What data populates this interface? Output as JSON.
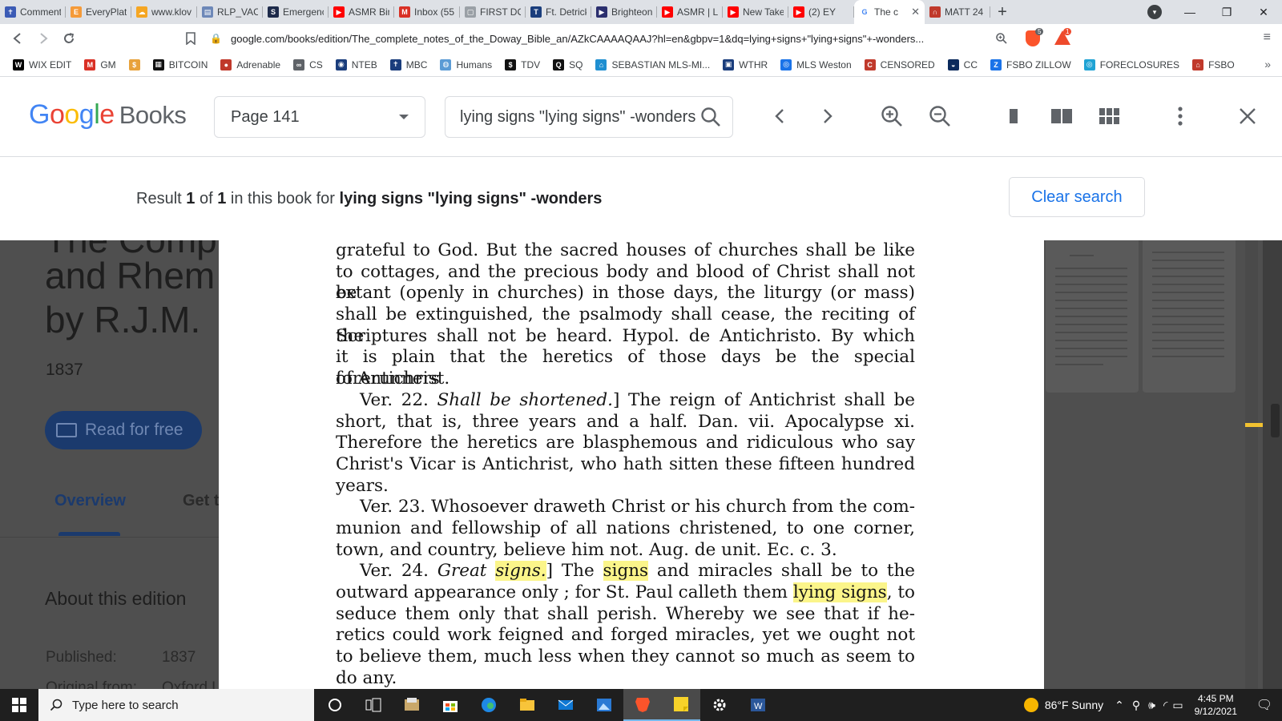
{
  "browser": {
    "tabs": [
      {
        "title": "Comment",
        "icon": "cross-icon",
        "color": "#3b5bb5"
      },
      {
        "title": "EveryPlate",
        "icon": "everyplate-icon",
        "color": "#f59a38"
      },
      {
        "title": "www.klov",
        "icon": "cloud-icon",
        "color": "#f5a623"
      },
      {
        "title": "RLP_VACC",
        "icon": "document-icon",
        "color": "#6d88b8"
      },
      {
        "title": "Emergenc",
        "icon": "shield-icon",
        "color": "#1d2a4a"
      },
      {
        "title": "ASMR Bin",
        "icon": "youtube-icon",
        "color": "#ff0000"
      },
      {
        "title": "Inbox (55",
        "icon": "gmail-icon",
        "color": "#d93025"
      },
      {
        "title": "FIRST DO",
        "icon": "page-icon",
        "color": "#9aa0a6"
      },
      {
        "title": "Ft. Detrick",
        "icon": "tru-icon",
        "color": "#1a3d7c"
      },
      {
        "title": "Brighteon",
        "icon": "play-icon",
        "color": "#2b2f6e"
      },
      {
        "title": "ASMR | L",
        "icon": "youtube-icon",
        "color": "#ff0000"
      },
      {
        "title": "New Take",
        "icon": "youtube-icon",
        "color": "#ff0000"
      },
      {
        "title": "(2) EY",
        "icon": "youtube-icon",
        "color": "#ff0000"
      },
      {
        "title": "The c",
        "icon": "google-icon",
        "color": "#4285f4",
        "active": true
      },
      {
        "title": "MATT 24",
        "icon": "headphones-icon",
        "color": "#c0392b"
      }
    ],
    "new_tab_symbol": "+",
    "url": "google.com/books/edition/The_complete_notes_of_the_Doway_Bible_an/AZkCAAAAQAAJ?hl=en&gbpv=1&dq=lying+signs+\"lying+signs\"+-wonders...",
    "brave_badge": "5",
    "rewards_badge": "1",
    "bookmarks": [
      {
        "label": "WIX EDIT",
        "icon": "wix-icon",
        "color": "#000000"
      },
      {
        "label": "GM",
        "icon": "gmail-icon",
        "color": "#d93025"
      },
      {
        "label": "",
        "icon": "coin-icon",
        "color": "#e8a23b"
      },
      {
        "label": "BITCOIN",
        "icon": "chart-icon",
        "color": "#111111"
      },
      {
        "label": "Adrenable",
        "icon": "circle-icon",
        "color": "#c0392b"
      },
      {
        "label": "CS",
        "icon": "link-icon",
        "color": "#5f6368"
      },
      {
        "label": "NTEB",
        "icon": "globe-icon",
        "color": "#1a3d7c"
      },
      {
        "label": "MBC",
        "icon": "cross-icon",
        "color": "#1a3d7c"
      },
      {
        "label": "Humans",
        "icon": "planet-icon",
        "color": "#5b9bd5"
      },
      {
        "label": "TDV",
        "icon": "dollar-icon",
        "color": "#111111"
      },
      {
        "label": "SQ",
        "icon": "q-icon",
        "color": "#111111"
      },
      {
        "label": "SEBASTIAN MLS-MI...",
        "icon": "house-icon",
        "color": "#1f8fd1"
      },
      {
        "label": "WTHR",
        "icon": "tv-icon",
        "color": "#1a3d7c"
      },
      {
        "label": "MLS Weston",
        "icon": "pin-icon",
        "color": "#1a73e8"
      },
      {
        "label": "CENSORED",
        "icon": "c-icon",
        "color": "#c0392b"
      },
      {
        "label": "CC",
        "icon": "helmet-icon",
        "color": "#0b2a5c"
      },
      {
        "label": "FSBO ZILLOW",
        "icon": "zillow-icon",
        "color": "#1a73e8"
      },
      {
        "label": "FORECLOSURES",
        "icon": "pin-icon",
        "color": "#1fa3d4"
      },
      {
        "label": "FSBO",
        "icon": "home-icon",
        "color": "#c0392b"
      }
    ],
    "bookmarks_more": "»"
  },
  "books": {
    "logo": {
      "google": "Google",
      "books": "Books"
    },
    "page_select": "Page 141",
    "search_value": "lying signs \"lying signs\" -wonders",
    "result": {
      "prefix": "Result",
      "current": "1",
      "of": "of",
      "total": "1",
      "middle": "in this book for",
      "query": "lying signs \"lying signs\" -wonders"
    },
    "clear_search": "Clear search",
    "background": {
      "title_lines": [
        "The Comp",
        "and Rhem",
        "by R.J.M."
      ],
      "year": "1837",
      "read_button": "Read for free",
      "tabs": [
        "Overview",
        "Get t"
      ],
      "about": "About this edition",
      "published_label": "Published:",
      "published_value": "1837",
      "original_label": "Original from:",
      "original_value": "Oxford U"
    }
  },
  "scan": {
    "lines": [
      {
        "text": "grateful to God.  But the sacred houses of churches shall be like"
      },
      {
        "text": "to cottages, and the precious body and blood of Christ shall not be"
      },
      {
        "text": "extant (openly in churches) in those days, the liturgy (or mass)"
      },
      {
        "text": "shall be extinguished, the psalmody shall cease, the reciting of the"
      },
      {
        "text": "Scriptures shall not be heard.  Hypol. de Antichristo.  By which"
      },
      {
        "text": "it is plain that the heretics of those days be the special forerunners"
      },
      {
        "text": "of Antichrist.",
        "last": true
      },
      {
        "pre": "Ver. 22.  ",
        "ital": "Shall be shortened.",
        "text": "]  The reign of Antichrist shall be",
        "indent": true
      },
      {
        "text": "short, that is, three years and a half.  Dan. vii. Apocalypse xi."
      },
      {
        "text": "Therefore the heretics are blasphemous and ridiculous who say"
      },
      {
        "text": "Christ's Vicar is Antichrist, who hath sitten these fifteen hundred"
      },
      {
        "text": "years.",
        "last": true
      },
      {
        "text": "Ver. 23.  Whosoever draweth Christ or his church from the com-",
        "indent": true
      },
      {
        "text": "munion and fellowship of all nations christened, to one corner,"
      },
      {
        "text": "town, and country, believe him not.  Aug. de unit. Ec. c. 3.",
        "last": true
      },
      {
        "pre": "Ver. 24.  ",
        "ital": "Great ",
        "hl_ital": "signs.",
        "text": "]  The ",
        "hl": "signs",
        "post": " and miracles shall be to the",
        "indent": true
      },
      {
        "text": "outward appearance only ; for St. Paul calleth them ",
        "hl": "lying signs",
        "post": ", to"
      },
      {
        "text": "seduce them only that shall perish.  Whereby we see that if he-"
      },
      {
        "text": "retics could work feigned and forged miracles, yet we ought not"
      },
      {
        "text": "to believe them, much less when they cannot so much as seem to"
      },
      {
        "text": "do any.",
        "last": true
      }
    ],
    "highlight_color": "#fbf58a"
  },
  "taskbar": {
    "search_placeholder": "Type here to search",
    "apps": [
      "cortana-icon",
      "task-view-icon",
      "files-icon",
      "store-icon",
      "edge-icon",
      "explorer-icon",
      "mail-icon",
      "photos-icon",
      "brave-icon",
      "sticky-notes-icon",
      "settings-icon",
      "word-icon"
    ],
    "weather": "86°F  Sunny",
    "time": "4:45 PM",
    "date": "9/12/2021"
  }
}
